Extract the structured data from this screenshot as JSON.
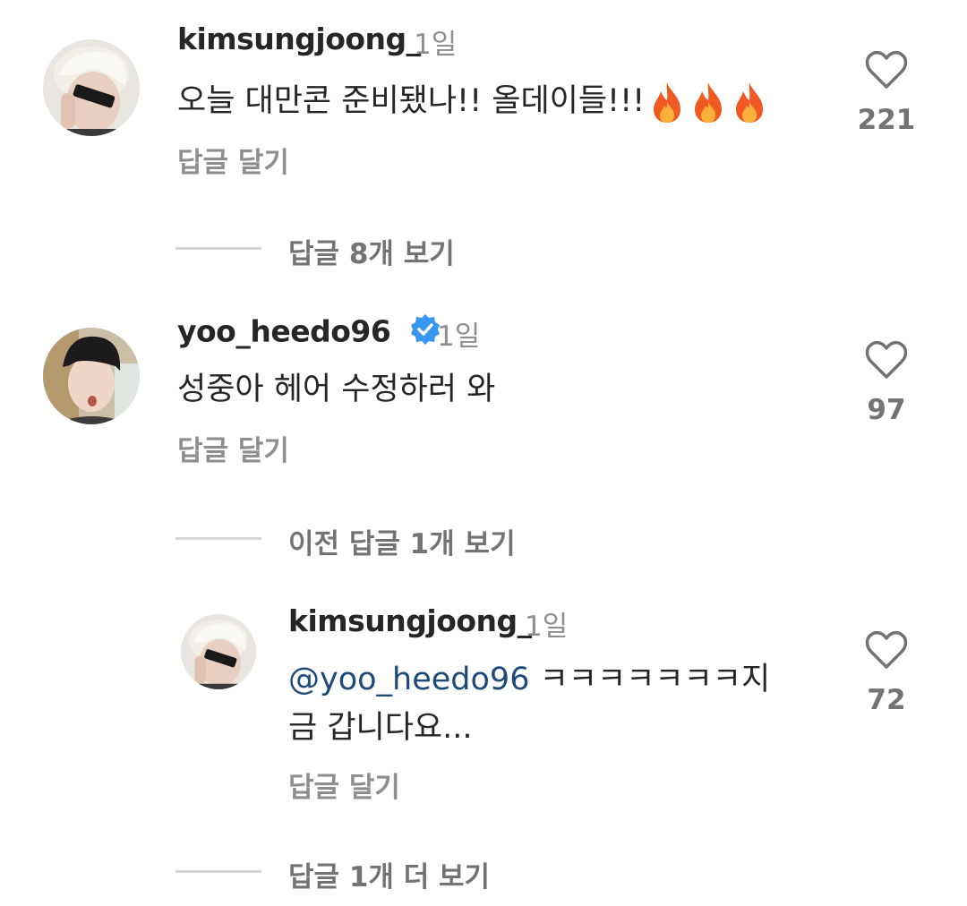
{
  "comments": [
    {
      "username": "kimsungjoong_",
      "time": "1일",
      "text": "오늘 대만콘 준비됐나!! 올데이들!!!",
      "emoji": [
        "fire",
        "fire",
        "fire"
      ],
      "likes": "221",
      "reply_label": "답글 달기",
      "thread_label": "답글 8개 보기"
    },
    {
      "username": "yoo_heedo96",
      "verified": true,
      "time": "1일",
      "text": "성중아 헤어 수정하러 와",
      "likes": "97",
      "reply_label": "답글 달기",
      "thread_label": "이전 답글 1개 보기"
    }
  ],
  "reply": {
    "username": "kimsungjoong_",
    "time": "1일",
    "mention": "@yoo_heedo96",
    "text_line1": " ㅋㅋㅋㅋㅋㅋㅋ지",
    "text_line2": "금 갑니다요...",
    "likes": "72",
    "reply_label": "답글 달기",
    "thread_label": "답글 1개 더 보기"
  },
  "colors": {
    "accent_verified": "#3897f0",
    "mention": "#1e4a7a",
    "muted": "#8e8e8e"
  },
  "icons": [
    "heart-outline-icon",
    "fire-emoji",
    "verified-badge-icon"
  ]
}
